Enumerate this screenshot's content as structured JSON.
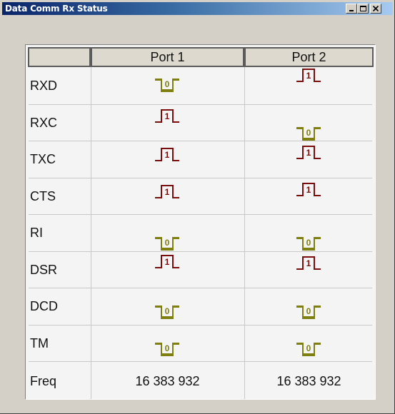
{
  "window": {
    "title": "Data Comm Rx Status"
  },
  "table": {
    "columns": [
      "",
      "Port 1",
      "Port 2"
    ],
    "rows": [
      {
        "label": "RXD",
        "port1": "0",
        "port2": "1"
      },
      {
        "label": "RXC",
        "port1": "1",
        "port2": "0"
      },
      {
        "label": "TXC",
        "port1": "1",
        "port2": "1"
      },
      {
        "label": "CTS",
        "port1": "1",
        "port2": "1"
      },
      {
        "label": "RI",
        "port1": "0",
        "port2": "0"
      },
      {
        "label": "DSR",
        "port1": "1",
        "port2": "1"
      },
      {
        "label": "DCD",
        "port1": "0",
        "port2": "0"
      },
      {
        "label": "TM",
        "port1": "0",
        "port2": "0"
      }
    ],
    "freq": {
      "label": "Freq",
      "port1": "16 383 932",
      "port2": "16 383 932"
    }
  },
  "colors": {
    "high": "#7a0d0d",
    "low": "#7f7f10"
  }
}
